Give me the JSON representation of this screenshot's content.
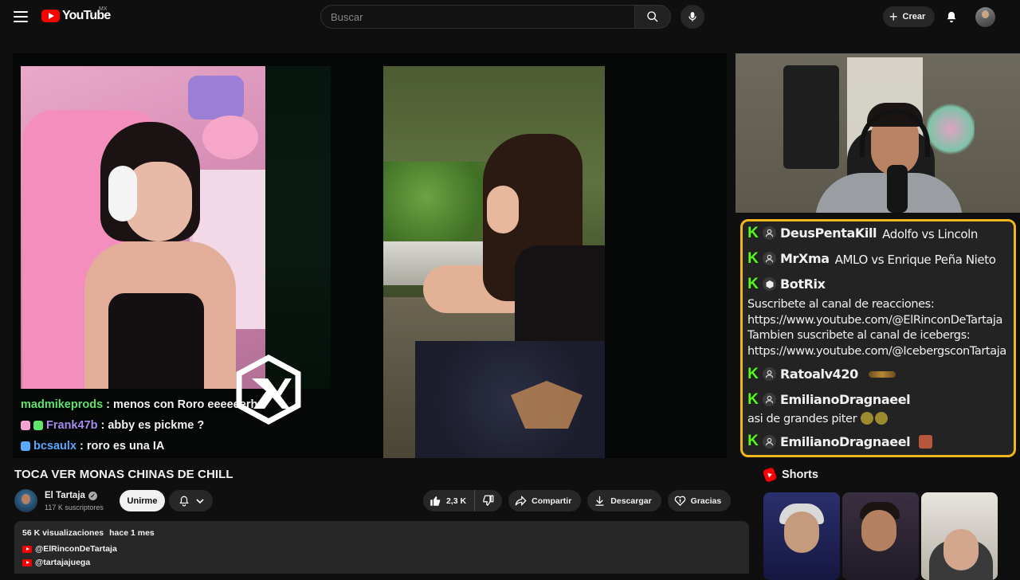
{
  "header": {
    "logo_text": "YouTube",
    "region": "MX",
    "search_placeholder": "Buscar",
    "create_label": "Crear"
  },
  "stream_chat": [
    {
      "user": "madmikeprods",
      "message": "menos con Roro eeeeeerh",
      "color": "#5fe36c"
    },
    {
      "user": "Frank47b",
      "message": "abby es pickme ?",
      "color": "#a88cf0"
    },
    {
      "user": "bcsaulx",
      "message": "roro es una IA",
      "color": "#5aa8ff"
    }
  ],
  "video": {
    "title": "TOCA VER MONAS CHINAS DE CHILL",
    "channel": "El Tartaja",
    "subscribers": "117 K suscriptores",
    "join_label": "Unirme",
    "likes": "2,3 K",
    "share_label": "Compartir",
    "download_label": "Descargar",
    "thanks_label": "Gracias",
    "views": "56 K visualizaciones",
    "age": "hace 1 mes",
    "links": [
      "@ElRinconDeTartaja",
      "@tartajajuega"
    ]
  },
  "kick_chat": {
    "accent": "#f2b51c",
    "lines": [
      {
        "user": "DeusPentaKill",
        "message": "Adolfo vs Lincoln"
      },
      {
        "user": "MrXma",
        "message": "AMLO vs Enrique Peña Nieto"
      },
      {
        "user": "BotRix",
        "message": ""
      }
    ],
    "bot_text": [
      "Suscribete al canal de reacciones:",
      "https://www.youtube.com/@ElRinconDeTartaja",
      "Tambien suscribete al canal de icebergs:",
      "https://www.youtube.com/@IcebergsconTartaja"
    ],
    "user4": "Ratoalv420",
    "user5": "EmilianoDragnaeel",
    "user5_message": "asi de grandes piter",
    "user6": "EmilianoDragnaeel"
  },
  "shorts": {
    "title": "Shorts"
  }
}
